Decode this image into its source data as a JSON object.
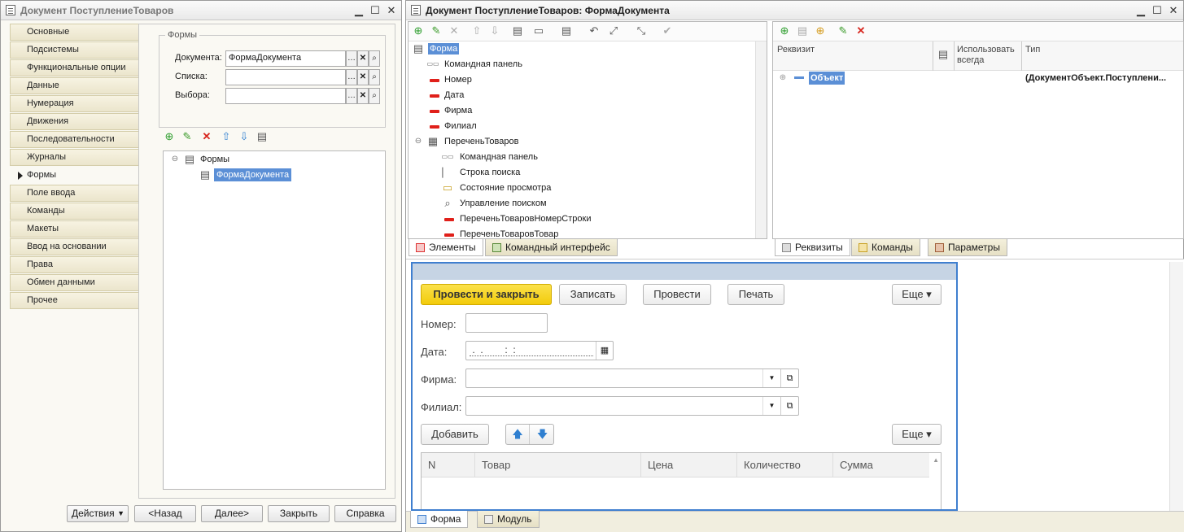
{
  "left_window": {
    "title": "Документ ПоступлениеТоваров",
    "tabs": [
      "Основные",
      "Подсистемы",
      "Функциональные опции",
      "Данные",
      "Нумерация",
      "Движения",
      "Последовательности",
      "Журналы",
      "Формы",
      "Поле ввода",
      "Команды",
      "Макеты",
      "Ввод на основании",
      "Права",
      "Обмен данными",
      "Прочее"
    ],
    "active_tab": "Формы",
    "group_title": "Формы",
    "fields": [
      {
        "label": "Документа:",
        "value": "ФормаДокумента"
      },
      {
        "label": "Списка:",
        "value": ""
      },
      {
        "label": "Выбора:",
        "value": ""
      }
    ],
    "tree_root": "Формы",
    "tree_child": "ФормаДокумента",
    "buttons": {
      "actions": "Действия",
      "back": "<Назад",
      "next": "Далее>",
      "close": "Закрыть",
      "help": "Справка"
    }
  },
  "right_window": {
    "title": "Документ ПоступлениеТоваров: ФормаДокумента",
    "elements_tree": [
      "Форма",
      "Командная панель",
      "Номер",
      "Дата",
      "Фирма",
      "Филиал",
      "ПереченьТоваров",
      "Командная панель",
      "Строка поиска",
      "Состояние просмотра",
      "Управление поиском",
      "ПереченьТоваровНомерСтроки",
      "ПереченьТоваровТовар"
    ],
    "left_tabs": [
      "Элементы",
      "Командный интерфейс"
    ],
    "attr_headers": {
      "rekvizit": "Реквизит",
      "use_always": "Использовать всегда",
      "type": "Тип"
    },
    "attr_row": {
      "name": "Объект",
      "type": "(ДокументОбъект.Поступлени..."
    },
    "right_tabs": [
      "Реквизиты",
      "Команды",
      "Параметры"
    ],
    "bottom_tabs": [
      "Форма",
      "Модуль"
    ]
  },
  "preview": {
    "btn_post_close": "Провести и закрыть",
    "btn_write": "Записать",
    "btn_post": "Провести",
    "btn_print": "Печать",
    "btn_more": "Еще ▾",
    "label_number": "Номер:",
    "label_date": "Дата:",
    "date_mask": " .  .        :  :",
    "label_firm": "Фирма:",
    "label_branch": "Филиал:",
    "btn_add": "Добавить",
    "table_headers": [
      "N",
      "Товар",
      "Цена",
      "Количество",
      "Сумма"
    ]
  },
  "colors": {
    "accent_yellow": "#f7d417",
    "selection": "#5b8fd6",
    "form_border": "#3f7fcf"
  }
}
